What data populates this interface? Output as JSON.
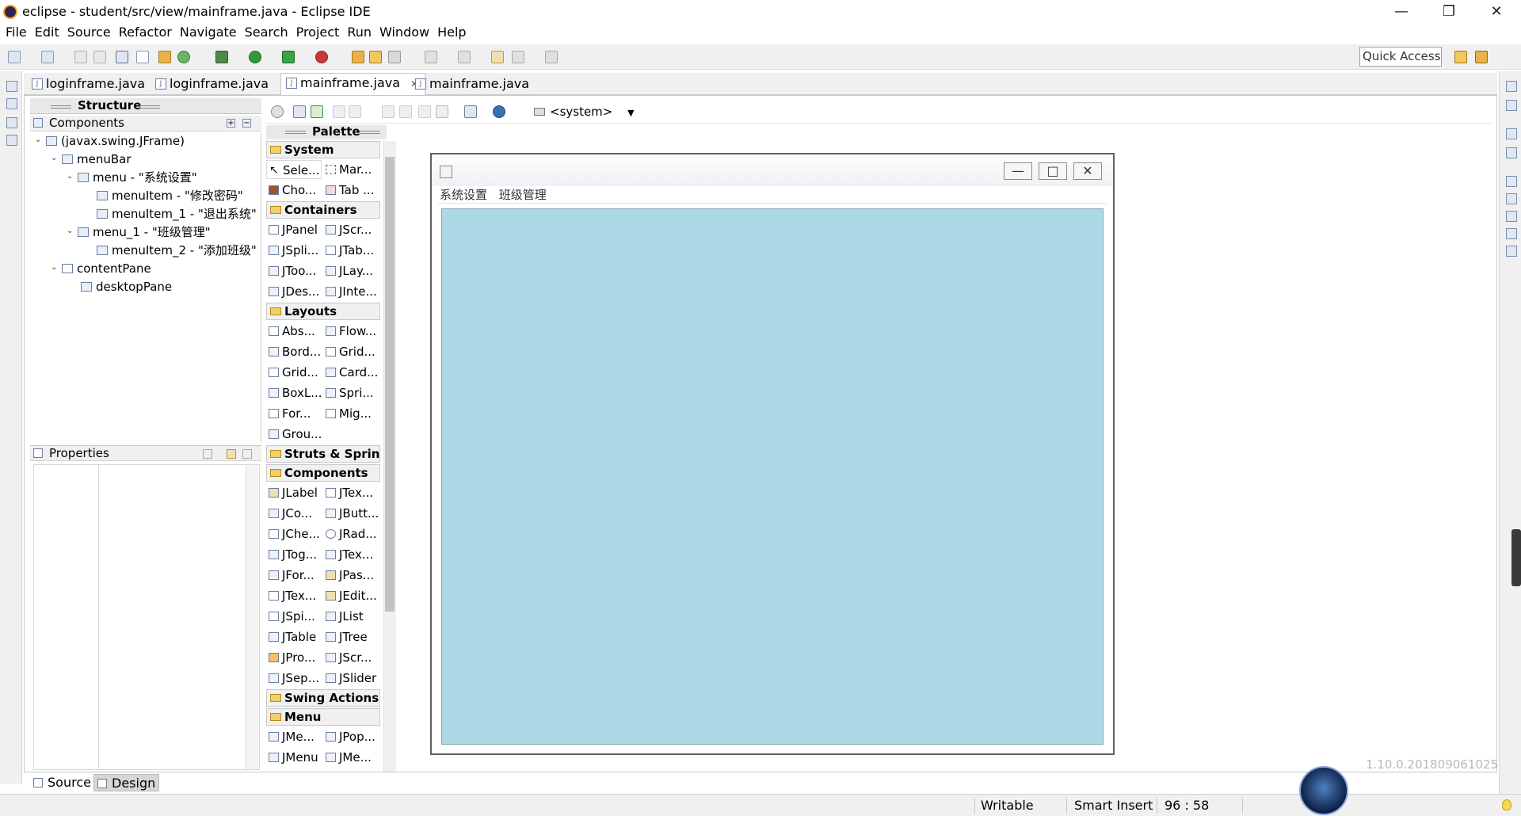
{
  "window": {
    "title": "eclipse - student/src/view/mainframe.java - Eclipse IDE",
    "minimize": "—",
    "restore": "❐",
    "close": "✕"
  },
  "menubar": [
    "File",
    "Edit",
    "Source",
    "Refactor",
    "Navigate",
    "Search",
    "Project",
    "Run",
    "Window",
    "Help"
  ],
  "toolbar": {
    "quick_access": "Quick Access"
  },
  "editor_tabs": [
    {
      "label": "loginframe.java",
      "active": false
    },
    {
      "label": "loginframe.java",
      "active": false
    },
    {
      "label": "mainframe.java",
      "active": true,
      "close": "✕"
    },
    {
      "label": "mainframe.java",
      "active": false
    }
  ],
  "structure": {
    "header": "Structure",
    "components_label": "Components",
    "tree": [
      "(javax.swing.JFrame)",
      "menuBar",
      "menu - \"系统设置\"",
      "menuItem - \"修改密码\"",
      "menuItem_1 - \"退出系统\"",
      "menu_1 - \"班级管理\"",
      "menuItem_2 - \"添加班级\"",
      "contentPane",
      "desktopPane"
    ]
  },
  "properties": {
    "header": "Properties"
  },
  "bottom_tabs": {
    "source": "Source",
    "design": "Design"
  },
  "palette_toolbar": {
    "system_selector": "<system>"
  },
  "palette": {
    "header": "Palette",
    "categories": {
      "system": "System",
      "containers": "Containers",
      "layouts": "Layouts",
      "struts": "Struts & Sprin...",
      "components": "Components",
      "swing_actions": "Swing Actions",
      "menu": "Menu"
    },
    "system_items": [
      "Sele...",
      "Mar...",
      "Cho...",
      "Tab ..."
    ],
    "container_items": [
      "JPanel",
      "JScr...",
      "JSpli...",
      "JTab...",
      "JToo...",
      "JLay...",
      "JDes...",
      "JInte..."
    ],
    "layout_items": [
      "Abs...",
      "Flow...",
      "Bord...",
      "Grid...",
      "Grid...",
      "Card...",
      "BoxL...",
      "Spri...",
      "For...",
      "Mig...",
      "Grou..."
    ],
    "component_items": [
      "JLabel",
      "JTex...",
      "JCo...",
      "JButt...",
      "JChe...",
      "JRad...",
      "JTog...",
      "JTex...",
      "JFor...",
      "JPas...",
      "JTex...",
      "JEdit...",
      "JSpi...",
      "JList",
      "JTable",
      "JTree",
      "JPro...",
      "JScr...",
      "JSep...",
      "JSlider"
    ],
    "menu_items": [
      "JMe...",
      "JPop...",
      "JMenu",
      "JMe..."
    ]
  },
  "design_frame": {
    "menus": [
      "系统设置",
      "班级管理"
    ],
    "desktop_color": "#add8e6",
    "btn_min": "—",
    "btn_max": "□",
    "btn_close": "✕"
  },
  "version": "1.10.0.201809061025",
  "status": {
    "writable": "Writable",
    "insert_mode": "Smart Insert",
    "position": "96 : 58"
  }
}
